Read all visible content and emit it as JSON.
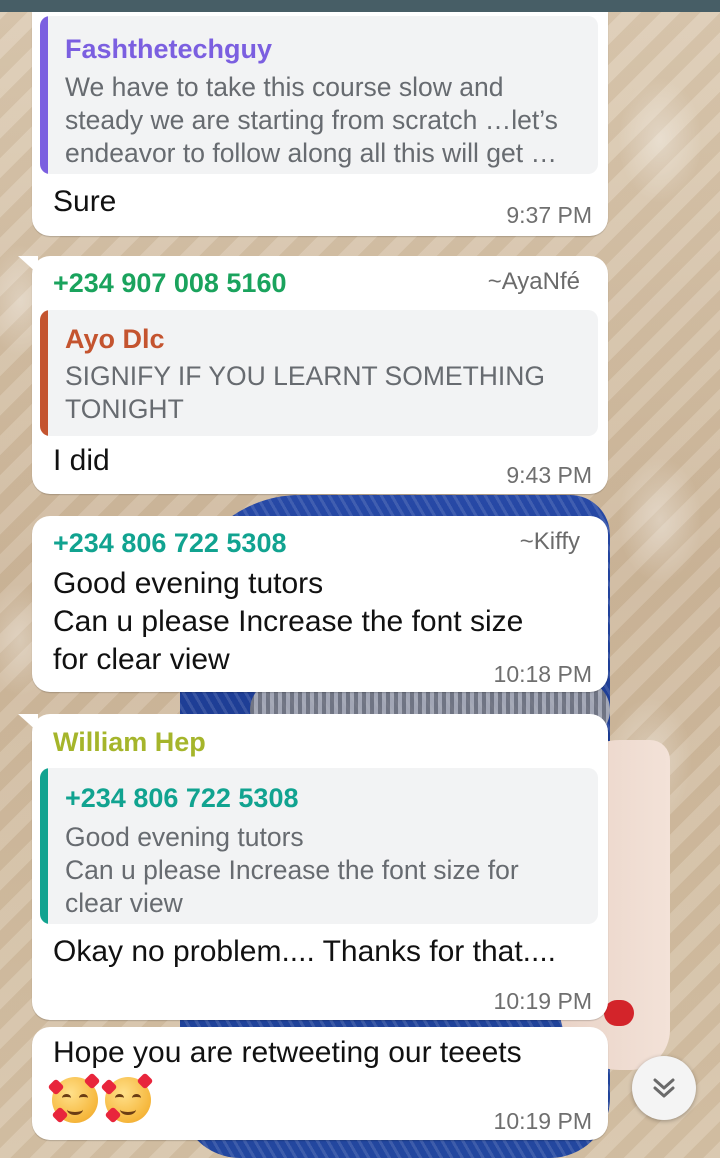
{
  "messages": [
    {
      "quote": {
        "name": "Fashthetechguy",
        "text": "We have to take this course slow and\nsteady we are starting from scratch …let’s\nendeavor to follow along all this will get …"
      },
      "text": "Sure",
      "time": "9:37 PM"
    },
    {
      "sender": "+234 907 008 5160",
      "alias": "~AyaNfé",
      "quote": {
        "name": "Ayo Dlc",
        "text": "SIGNIFY IF YOU LEARNT SOMETHING\nTONIGHT"
      },
      "text": "I did",
      "time": "9:43 PM"
    },
    {
      "sender": "+234 806 722 5308",
      "alias": "~Kiffy",
      "text": "Good evening tutors\nCan u please Increase the font size\nfor clear view",
      "time": "10:18 PM"
    },
    {
      "sender": "William Hep",
      "quote": {
        "name": "+234 806 722 5308",
        "text": "Good evening tutors\nCan u please Increase the font size for\nclear view"
      },
      "text": "Okay no problem.... Thanks for that....",
      "time": "10:19 PM"
    },
    {
      "text": "Hope you are retweeting our teeets",
      "emoji": [
        "smiling-face-with-hearts",
        "smiling-face-with-hearts"
      ],
      "time": "10:19 PM"
    }
  ],
  "colors": {
    "fashthetechguy": "#7b5fe0",
    "ayo_dlc": "#c4542f",
    "sender_green": "#1aa35d",
    "sender_teal": "#11a390",
    "william_hep": "#a5b52b",
    "quote_bg": "#f2f3f4"
  },
  "scroll_button": {
    "icon": "double-chevron-down-icon"
  }
}
